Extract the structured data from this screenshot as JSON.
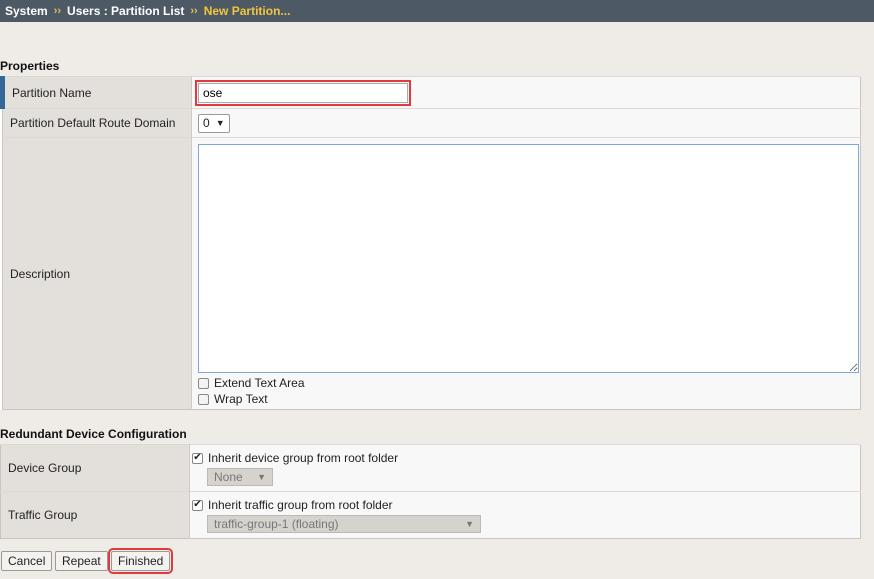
{
  "breadcrumb": {
    "system": "System",
    "sep": "››",
    "users": "Users : Partition List",
    "current": "New Partition..."
  },
  "properties": {
    "title": "Properties",
    "partition_name_label": "Partition Name",
    "partition_name_value": "ose",
    "route_domain_label": "Partition Default Route Domain",
    "route_domain_value": "0",
    "description_label": "Description",
    "description_value": "",
    "extend_text_area": "Extend Text Area",
    "wrap_text": "Wrap Text"
  },
  "redundant": {
    "title": "Redundant Device Configuration",
    "device_group_label": "Device Group",
    "device_group_inherit": "Inherit device group from root folder",
    "device_group_value": "None",
    "traffic_group_label": "Traffic Group",
    "traffic_group_inherit": "Inherit traffic group from root folder",
    "traffic_group_value": "traffic-group-1 (floating)"
  },
  "actions": {
    "cancel": "Cancel",
    "repeat": "Repeat",
    "finished": "Finished"
  },
  "colors": {
    "topbar": "#4d5a66",
    "breadcrumb_current": "#f2c53d",
    "highlight": "#e0393e",
    "label_active": "#336699"
  }
}
